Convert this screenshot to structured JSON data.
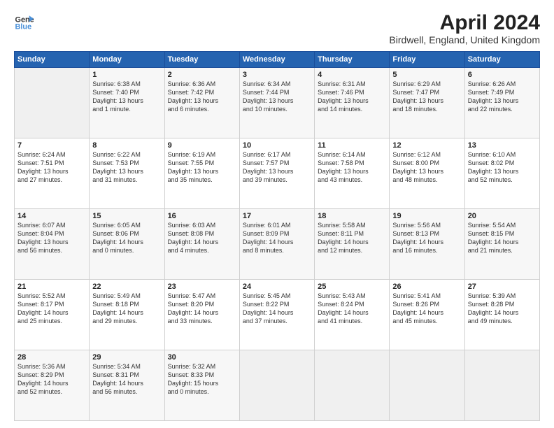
{
  "header": {
    "logo_line1": "General",
    "logo_line2": "Blue",
    "title": "April 2024",
    "subtitle": "Birdwell, England, United Kingdom"
  },
  "days_of_week": [
    "Sunday",
    "Monday",
    "Tuesday",
    "Wednesday",
    "Thursday",
    "Friday",
    "Saturday"
  ],
  "weeks": [
    [
      {
        "day": "",
        "info": ""
      },
      {
        "day": "1",
        "info": "Sunrise: 6:38 AM\nSunset: 7:40 PM\nDaylight: 13 hours\nand 1 minute."
      },
      {
        "day": "2",
        "info": "Sunrise: 6:36 AM\nSunset: 7:42 PM\nDaylight: 13 hours\nand 6 minutes."
      },
      {
        "day": "3",
        "info": "Sunrise: 6:34 AM\nSunset: 7:44 PM\nDaylight: 13 hours\nand 10 minutes."
      },
      {
        "day": "4",
        "info": "Sunrise: 6:31 AM\nSunset: 7:46 PM\nDaylight: 13 hours\nand 14 minutes."
      },
      {
        "day": "5",
        "info": "Sunrise: 6:29 AM\nSunset: 7:47 PM\nDaylight: 13 hours\nand 18 minutes."
      },
      {
        "day": "6",
        "info": "Sunrise: 6:26 AM\nSunset: 7:49 PM\nDaylight: 13 hours\nand 22 minutes."
      }
    ],
    [
      {
        "day": "7",
        "info": "Sunrise: 6:24 AM\nSunset: 7:51 PM\nDaylight: 13 hours\nand 27 minutes."
      },
      {
        "day": "8",
        "info": "Sunrise: 6:22 AM\nSunset: 7:53 PM\nDaylight: 13 hours\nand 31 minutes."
      },
      {
        "day": "9",
        "info": "Sunrise: 6:19 AM\nSunset: 7:55 PM\nDaylight: 13 hours\nand 35 minutes."
      },
      {
        "day": "10",
        "info": "Sunrise: 6:17 AM\nSunset: 7:57 PM\nDaylight: 13 hours\nand 39 minutes."
      },
      {
        "day": "11",
        "info": "Sunrise: 6:14 AM\nSunset: 7:58 PM\nDaylight: 13 hours\nand 43 minutes."
      },
      {
        "day": "12",
        "info": "Sunrise: 6:12 AM\nSunset: 8:00 PM\nDaylight: 13 hours\nand 48 minutes."
      },
      {
        "day": "13",
        "info": "Sunrise: 6:10 AM\nSunset: 8:02 PM\nDaylight: 13 hours\nand 52 minutes."
      }
    ],
    [
      {
        "day": "14",
        "info": "Sunrise: 6:07 AM\nSunset: 8:04 PM\nDaylight: 13 hours\nand 56 minutes."
      },
      {
        "day": "15",
        "info": "Sunrise: 6:05 AM\nSunset: 8:06 PM\nDaylight: 14 hours\nand 0 minutes."
      },
      {
        "day": "16",
        "info": "Sunrise: 6:03 AM\nSunset: 8:08 PM\nDaylight: 14 hours\nand 4 minutes."
      },
      {
        "day": "17",
        "info": "Sunrise: 6:01 AM\nSunset: 8:09 PM\nDaylight: 14 hours\nand 8 minutes."
      },
      {
        "day": "18",
        "info": "Sunrise: 5:58 AM\nSunset: 8:11 PM\nDaylight: 14 hours\nand 12 minutes."
      },
      {
        "day": "19",
        "info": "Sunrise: 5:56 AM\nSunset: 8:13 PM\nDaylight: 14 hours\nand 16 minutes."
      },
      {
        "day": "20",
        "info": "Sunrise: 5:54 AM\nSunset: 8:15 PM\nDaylight: 14 hours\nand 21 minutes."
      }
    ],
    [
      {
        "day": "21",
        "info": "Sunrise: 5:52 AM\nSunset: 8:17 PM\nDaylight: 14 hours\nand 25 minutes."
      },
      {
        "day": "22",
        "info": "Sunrise: 5:49 AM\nSunset: 8:18 PM\nDaylight: 14 hours\nand 29 minutes."
      },
      {
        "day": "23",
        "info": "Sunrise: 5:47 AM\nSunset: 8:20 PM\nDaylight: 14 hours\nand 33 minutes."
      },
      {
        "day": "24",
        "info": "Sunrise: 5:45 AM\nSunset: 8:22 PM\nDaylight: 14 hours\nand 37 minutes."
      },
      {
        "day": "25",
        "info": "Sunrise: 5:43 AM\nSunset: 8:24 PM\nDaylight: 14 hours\nand 41 minutes."
      },
      {
        "day": "26",
        "info": "Sunrise: 5:41 AM\nSunset: 8:26 PM\nDaylight: 14 hours\nand 45 minutes."
      },
      {
        "day": "27",
        "info": "Sunrise: 5:39 AM\nSunset: 8:28 PM\nDaylight: 14 hours\nand 49 minutes."
      }
    ],
    [
      {
        "day": "28",
        "info": "Sunrise: 5:36 AM\nSunset: 8:29 PM\nDaylight: 14 hours\nand 52 minutes."
      },
      {
        "day": "29",
        "info": "Sunrise: 5:34 AM\nSunset: 8:31 PM\nDaylight: 14 hours\nand 56 minutes."
      },
      {
        "day": "30",
        "info": "Sunrise: 5:32 AM\nSunset: 8:33 PM\nDaylight: 15 hours\nand 0 minutes."
      },
      {
        "day": "",
        "info": ""
      },
      {
        "day": "",
        "info": ""
      },
      {
        "day": "",
        "info": ""
      },
      {
        "day": "",
        "info": ""
      }
    ]
  ]
}
